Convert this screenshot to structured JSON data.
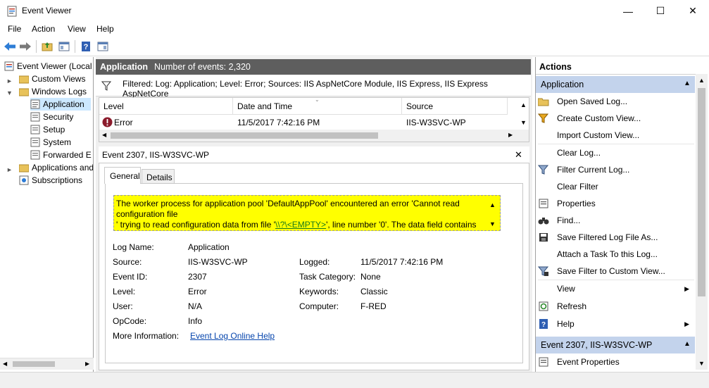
{
  "window": {
    "title": "Event Viewer",
    "controls": {
      "minimize": "—",
      "maximize": "☐",
      "close": "✕"
    }
  },
  "menu": {
    "items": [
      "File",
      "Action",
      "View",
      "Help"
    ]
  },
  "tree": {
    "root": "Event Viewer (Local",
    "custom_views": "Custom Views",
    "windows_logs": "Windows Logs",
    "application": "Application",
    "security": "Security",
    "setup": "Setup",
    "system": "System",
    "forwarded": "Forwarded E",
    "apps_services": "Applications and",
    "subscriptions": "Subscriptions"
  },
  "center": {
    "header_title": "Application",
    "event_count": "Number of events: 2,320",
    "filter_text": "Filtered: Log: Application; Level: Error; Sources: IIS AspNetCore Module, IIS Express, IIS Express AspNetCore",
    "columns": {
      "level": "Level",
      "date": "Date and Time",
      "source": "Source"
    },
    "row": {
      "level": "Error",
      "date": "11/5/2017 7:42:16 PM",
      "source": "IIS-W3SVC-WP"
    }
  },
  "detail": {
    "title": "Event 2307, IIS-W3SVC-WP",
    "close": "✕",
    "tabs": {
      "general": "General",
      "details": "Details"
    },
    "description": {
      "line1": "The worker process for application pool 'DefaultAppPool' encountered an error 'Cannot read",
      "line2": "configuration file",
      "line3_prefix": "' trying to read configuration data from file '",
      "line3_link": "\\\\?\\<EMPTY>",
      "line3_suffix": "', line number '0'.  The data field contains"
    },
    "props": {
      "log_name_label": "Log Name:",
      "log_name": "Application",
      "source_label": "Source:",
      "source": "IIS-W3SVC-WP",
      "logged_label": "Logged:",
      "logged": "11/5/2017 7:42:16 PM",
      "event_id_label": "Event ID:",
      "event_id": "2307",
      "task_label": "Task Category:",
      "task": "None",
      "level_label": "Level:",
      "level": "Error",
      "keywords_label": "Keywords:",
      "keywords": "Classic",
      "user_label": "User:",
      "user": "N/A",
      "computer_label": "Computer:",
      "computer": "F-RED",
      "opcode_label": "OpCode:",
      "opcode": "Info",
      "more_label": "More Information:",
      "more_link": "Event Log Online Help"
    }
  },
  "actions": {
    "title": "Actions",
    "section1": "Application",
    "items": [
      "Open Saved Log...",
      "Create Custom View...",
      "Import Custom View...",
      "Clear Log...",
      "Filter Current Log...",
      "Clear Filter",
      "Properties",
      "Find...",
      "Save Filtered Log File As...",
      "Attach a Task To this Log...",
      "Save Filter to Custom View...",
      "View",
      "Refresh",
      "Help"
    ],
    "section2": "Event 2307, IIS-W3SVC-WP",
    "event_items": [
      "Event Properties"
    ]
  },
  "colors": {
    "header_bg": "#5e5e5e",
    "section_bg": "#c3d3ec",
    "selection": "#cce8ff",
    "highlight": "#ffff00",
    "link": "#0645ad"
  }
}
